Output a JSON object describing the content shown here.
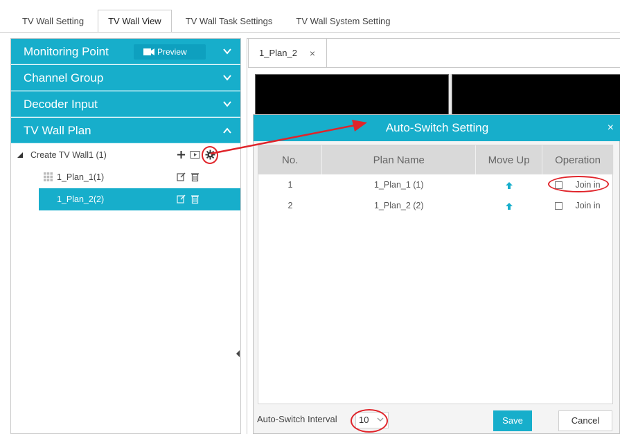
{
  "top_tabs": [
    "TV Wall Setting",
    "TV Wall View",
    "TV Wall Task Settings",
    "TV Wall System Setting"
  ],
  "active_top_tab": "TV Wall View",
  "left_panel": {
    "accordion": {
      "monitoring_point": "Monitoring Point",
      "preview_button": "Preview",
      "channel_group": "Channel Group",
      "decoder_input": "Decoder Input",
      "tv_wall_plan": "TV Wall Plan"
    },
    "tree": {
      "root_label": "Create TV Wall1 (1)",
      "plans": [
        "1_Plan_1(1)",
        "1_Plan_2(2)"
      ],
      "selected_plan": "1_Plan_2(2)"
    }
  },
  "right_panel": {
    "tab_label": "1_Plan_2",
    "tab_close": "×"
  },
  "dialog": {
    "title": "Auto-Switch Setting",
    "close": "×",
    "columns": {
      "no": "No.",
      "plan_name": "Plan Name",
      "move_up": "Move Up",
      "operation": "Operation"
    },
    "rows": [
      {
        "no": "1",
        "plan_name": "1_Plan_1 (1)",
        "operation": "Join in",
        "checked": false
      },
      {
        "no": "2",
        "plan_name": "1_Plan_2 (2)",
        "operation": "Join in",
        "checked": false
      }
    ],
    "interval_label": "Auto-Switch Interval",
    "interval_value": "10",
    "save": "Save",
    "cancel": "Cancel"
  },
  "colors": {
    "accent": "#17aecb",
    "highlight_annotation": "#e0242a",
    "table_header": "#d9d9d9"
  },
  "icons": [
    "camera-icon",
    "chevron-down-icon",
    "chevron-up-icon",
    "triangle-expander-icon",
    "plus-icon",
    "play-icon",
    "gear-icon",
    "grid-icon",
    "edit-icon",
    "trash-icon",
    "arrow-up-icon",
    "close-icon",
    "checkbox-icon"
  ]
}
